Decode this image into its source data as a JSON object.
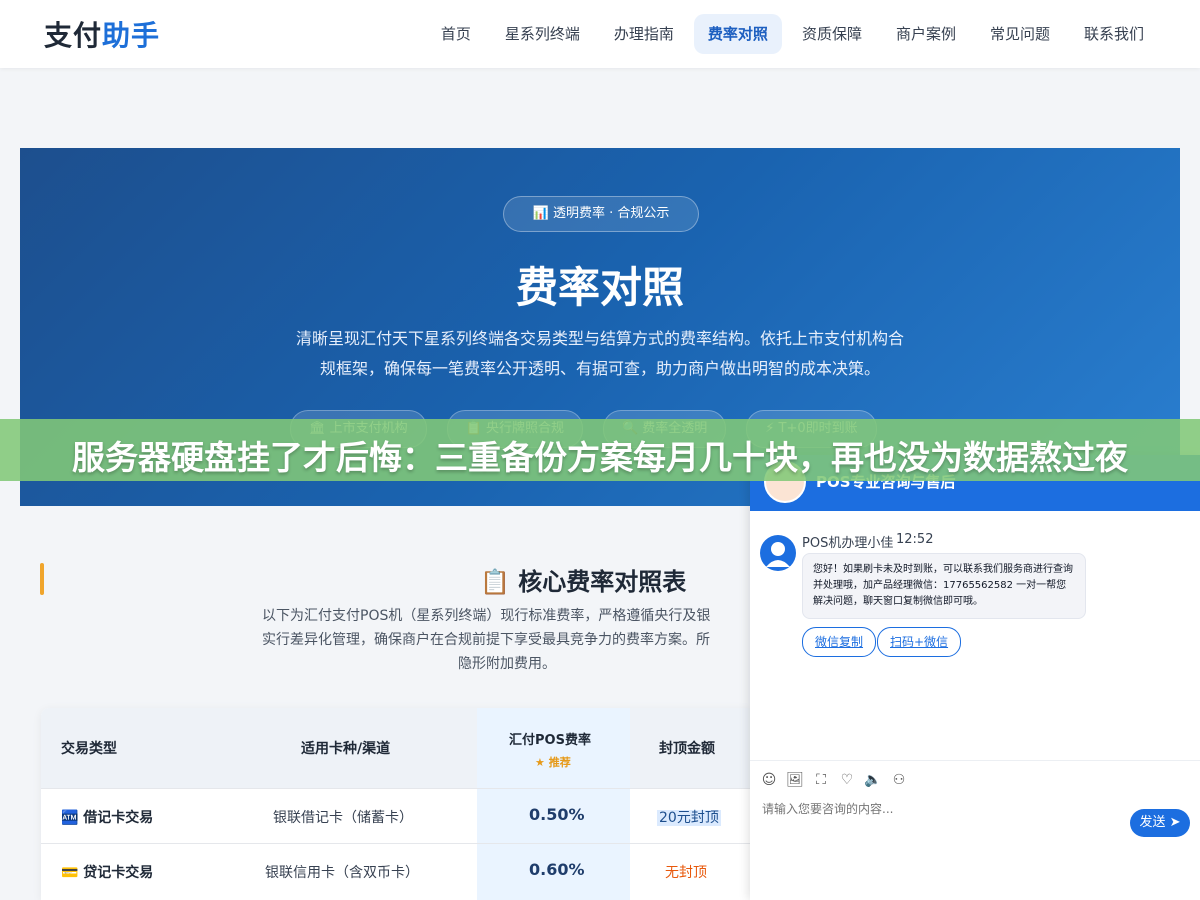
{
  "header": {
    "logo_part1": "支付",
    "logo_part2": "助手",
    "nav": [
      "首页",
      "星系列终端",
      "办理指南",
      "费率对照",
      "资质保障",
      "商户案例",
      "常见问题",
      "联系我们"
    ],
    "active_index": 3
  },
  "hero": {
    "badge": "📊 透明费率 · 合规公示",
    "title": "费率对照",
    "desc_line1": "清晰呈现汇付天下星系列终端各交易类型与结算方式的费率结构。依托上市支付机构合",
    "desc_line2": "规框架，确保每一笔费率公开透明、有据可查，助力商户做出明智的成本决策。",
    "pills": [
      "🏛 上市支付机构",
      "📋 央行牌照合规",
      "🔍 费率全透明",
      "⚡ T+0即时到账"
    ]
  },
  "banner": {
    "text": "服务器硬盘挂了才后悔：三重备份方案每月几十块，再也没为数据熬过夜"
  },
  "section": {
    "title": "📋 核心费率对照表",
    "desc_line1": "以下为汇付支付POS机（星系列终端）现行标准费率，严格遵循央行及银",
    "desc_line2": "实行差异化管理，确保商户在合规前提下享受最具竞争力的费率方案。所",
    "desc_line3": "隐形附加费用。"
  },
  "table": {
    "headers": [
      "交易类型",
      "适用卡种/渠道",
      "汇付POS费率",
      "封顶金额"
    ],
    "recommend": "★ 推荐",
    "rows": [
      {
        "type": "🏧 借记卡交易",
        "channel": "银联借记卡（储蓄卡）",
        "rate": "0.50%",
        "cap": "20元封顶"
      },
      {
        "type": "💳 贷记卡交易",
        "channel": "银联信用卡（含双币卡）",
        "rate": "0.60%",
        "cap": "无封顶"
      }
    ]
  },
  "chat": {
    "title": "POS专业咨询与售后",
    "agent_name": "POS机办理小佳",
    "time": "12:52",
    "message": "您好！如果刷卡未及时到账，可以联系我们服务商进行查询并处理哦，加产品经理微信：17765562582 一对一帮您解决问题，聊天窗口复制微信即可哦。",
    "btn_copy": "微信复制",
    "btn_scan": "扫码+微信",
    "input_placeholder": "请输入您要咨询的内容...",
    "send": "发送 ➤",
    "tools": [
      "☺",
      "🖼",
      "⛶",
      "♡",
      "🔈",
      "⚇"
    ]
  },
  "colors": {
    "brand": "#1d6fd8",
    "accent": "#f0a52c",
    "banner": "#82c878"
  }
}
